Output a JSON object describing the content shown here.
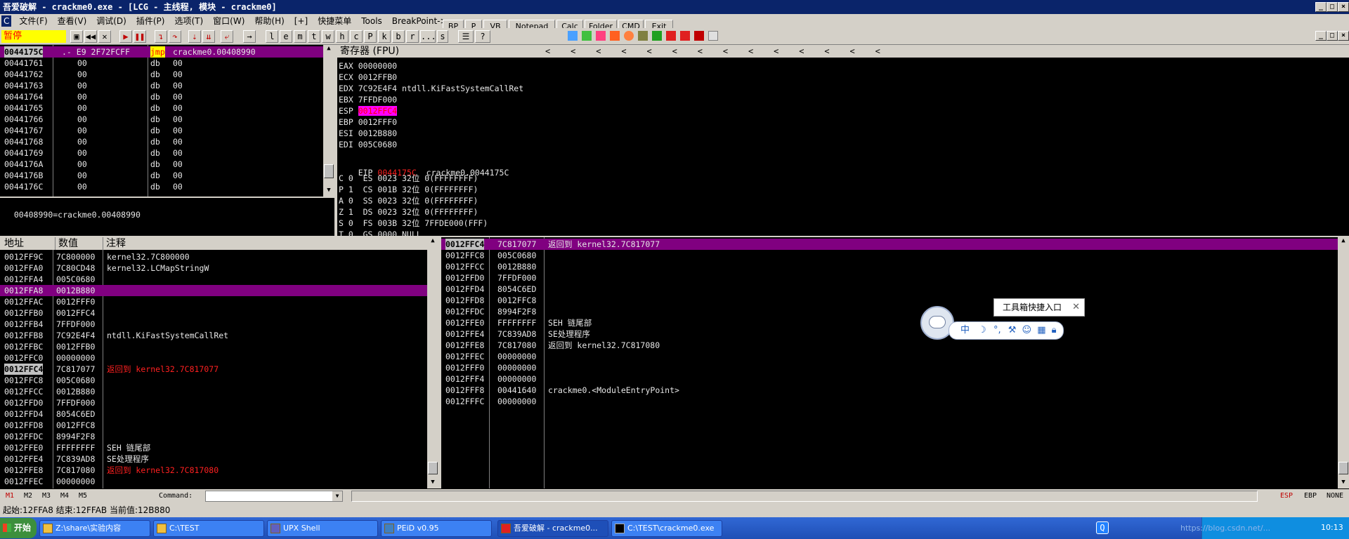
{
  "window": {
    "title": "吾爱破解 - crackme0.exe - [LCG - 主线程, 模块 - crackme0]"
  },
  "menu": [
    "C",
    "文件(F)",
    "查看(V)",
    "调试(D)",
    "插件(P)",
    "选项(T)",
    "窗口(W)",
    "帮助(H)",
    "[+]",
    "快捷菜单",
    "Tools",
    "BreakPoint->"
  ],
  "status_badge": "暂停",
  "toolbar_letters": [
    "l",
    "e",
    "m",
    "t",
    "w",
    "h",
    "c",
    "P",
    "k",
    "b",
    "r",
    "...",
    "s"
  ],
  "plugins": [
    "BP",
    "P",
    "VB",
    "Notepad",
    "Calc",
    "Folder",
    "CMD",
    "Exit"
  ],
  "disasm": {
    "rows": [
      {
        "addr": "0044175C",
        "hex": ".- E9 2F72FCFF",
        "cmd": "jmp",
        "arg": "crackme0.00408990"
      },
      {
        "addr": "00441761",
        "hex": "00",
        "cmd": "db",
        "arg": "00"
      },
      {
        "addr": "00441762",
        "hex": "00",
        "cmd": "db",
        "arg": "00"
      },
      {
        "addr": "00441763",
        "hex": "00",
        "cmd": "db",
        "arg": "00"
      },
      {
        "addr": "00441764",
        "hex": "00",
        "cmd": "db",
        "arg": "00"
      },
      {
        "addr": "00441765",
        "hex": "00",
        "cmd": "db",
        "arg": "00"
      },
      {
        "addr": "00441766",
        "hex": "00",
        "cmd": "db",
        "arg": "00"
      },
      {
        "addr": "00441767",
        "hex": "00",
        "cmd": "db",
        "arg": "00"
      },
      {
        "addr": "00441768",
        "hex": "00",
        "cmd": "db",
        "arg": "00"
      },
      {
        "addr": "00441769",
        "hex": "00",
        "cmd": "db",
        "arg": "00"
      },
      {
        "addr": "0044176A",
        "hex": "00",
        "cmd": "db",
        "arg": "00"
      },
      {
        "addr": "0044176B",
        "hex": "00",
        "cmd": "db",
        "arg": "00"
      },
      {
        "addr": "0044176C",
        "hex": "00",
        "cmd": "db",
        "arg": "00"
      }
    ],
    "info": "00408990=crackme0.00408990"
  },
  "registers": {
    "title": "寄存器 (FPU)",
    "arrows": "<    <    <    <    <    <    <    <    <    <    <    <    <    <",
    "gp": [
      {
        "name": "EAX",
        "value": "00000000",
        "note": ""
      },
      {
        "name": "ECX",
        "value": "0012FFB0",
        "note": ""
      },
      {
        "name": "EDX",
        "value": "7C92E4F4",
        "note": "ntdll.KiFastSystemCallRet"
      },
      {
        "name": "EBX",
        "value": "7FFDF000",
        "note": ""
      },
      {
        "name": "ESP",
        "value": "0012FFC4",
        "note": ""
      },
      {
        "name": "EBP",
        "value": "0012FFF0",
        "note": ""
      },
      {
        "name": "ESI",
        "value": "0012B880",
        "note": ""
      },
      {
        "name": "EDI",
        "value": "005C0680",
        "note": ""
      }
    ],
    "eip": {
      "name": "EIP",
      "value": "0044175C",
      "note": "crackme0.0044175C"
    },
    "flags": [
      "C 0  ES 0023 32位 0(FFFFFFFF)",
      "P 1  CS 001B 32位 0(FFFFFFFF)",
      "A 0  SS 0023 32位 0(FFFFFFFF)",
      "Z 1  DS 0023 32位 0(FFFFFFFF)",
      "S 0  FS 003B 32位 7FFDE000(FFF)",
      "T 0  GS 0000 NULL"
    ]
  },
  "dump": {
    "headers": [
      "地址",
      "数值",
      "注释"
    ],
    "rows": [
      {
        "addr": "0012FF9C",
        "val": "7C800000",
        "note": "kernel32.7C800000"
      },
      {
        "addr": "0012FFA0",
        "val": "7C80CD48",
        "note": "kernel32.LCMapStringW"
      },
      {
        "addr": "0012FFA4",
        "val": "005C0680",
        "note": ""
      },
      {
        "addr": "0012FFA8",
        "val": "0012B880",
        "note": ""
      },
      {
        "addr": "0012FFAC",
        "val": "0012FFF0",
        "note": ""
      },
      {
        "addr": "0012FFB0",
        "val": "0012FFC4",
        "note": ""
      },
      {
        "addr": "0012FFB4",
        "val": "7FFDF000",
        "note": ""
      },
      {
        "addr": "0012FFB8",
        "val": "7C92E4F4",
        "note": "ntdll.KiFastSystemCallRet"
      },
      {
        "addr": "0012FFBC",
        "val": "0012FFB0",
        "note": ""
      },
      {
        "addr": "0012FFC0",
        "val": "00000000",
        "note": ""
      },
      {
        "addr": "0012FFC4",
        "val": "7C817077",
        "note": "返回到 kernel32.7C817077"
      },
      {
        "addr": "0012FFC8",
        "val": "005C0680",
        "note": ""
      },
      {
        "addr": "0012FFCC",
        "val": "0012B880",
        "note": ""
      },
      {
        "addr": "0012FFD0",
        "val": "7FFDF000",
        "note": ""
      },
      {
        "addr": "0012FFD4",
        "val": "8054C6ED",
        "note": ""
      },
      {
        "addr": "0012FFD8",
        "val": "0012FFC8",
        "note": ""
      },
      {
        "addr": "0012FFDC",
        "val": "8994F2F8",
        "note": ""
      },
      {
        "addr": "0012FFE0",
        "val": "FFFFFFFF",
        "note": "SEH 链尾部"
      },
      {
        "addr": "0012FFE4",
        "val": "7C839AD8",
        "note": "SE处理程序"
      },
      {
        "addr": "0012FFE8",
        "val": "7C817080",
        "note": "返回到 kernel32.7C817080"
      },
      {
        "addr": "0012FFEC",
        "val": "00000000",
        "note": ""
      }
    ]
  },
  "stack": {
    "rows": [
      {
        "addr": "0012FFC4",
        "val": "7C817077",
        "note": "返回到 kernel32.7C817077"
      },
      {
        "addr": "0012FFC8",
        "val": "005C0680",
        "note": ""
      },
      {
        "addr": "0012FFCC",
        "val": "0012B880",
        "note": ""
      },
      {
        "addr": "0012FFD0",
        "val": "7FFDF000",
        "note": ""
      },
      {
        "addr": "0012FFD4",
        "val": "8054C6ED",
        "note": ""
      },
      {
        "addr": "0012FFD8",
        "val": "0012FFC8",
        "note": ""
      },
      {
        "addr": "0012FFDC",
        "val": "8994F2F8",
        "note": ""
      },
      {
        "addr": "0012FFE0",
        "val": "FFFFFFFF",
        "note": "SEH 链尾部"
      },
      {
        "addr": "0012FFE4",
        "val": "7C839AD8",
        "note": "SE处理程序"
      },
      {
        "addr": "0012FFE8",
        "val": "7C817080",
        "note": "返回到 kernel32.7C817080"
      },
      {
        "addr": "0012FFEC",
        "val": "00000000",
        "note": ""
      },
      {
        "addr": "0012FFF0",
        "val": "00000000",
        "note": ""
      },
      {
        "addr": "0012FFF4",
        "val": "00000000",
        "note": ""
      },
      {
        "addr": "0012FFF8",
        "val": "00441640",
        "note": "crackme0.<ModuleEntryPoint>"
      },
      {
        "addr": "0012FFFC",
        "val": "00000000",
        "note": ""
      }
    ]
  },
  "tooltip": {
    "text": "工具箱快捷入口",
    "ime_char": "中"
  },
  "cmdbar": {
    "marks": [
      "M1",
      "M2",
      "M3",
      "M4",
      "M5"
    ],
    "command_label": "Command:",
    "right": [
      "ESP",
      "EBP",
      "NONE"
    ]
  },
  "status": "起始:12FFA8 结束:12FFAB 当前值:12B880",
  "taskbar": {
    "start": "开始",
    "tasks": [
      "Z:\\share\\实验内容",
      "C:\\TEST",
      "UPX Shell",
      "PEiD v0.95",
      "吾爱破解 - crackme0...",
      "C:\\TEST\\crackme0.exe"
    ],
    "clock": "10:13",
    "watermark": "https://blog.csdn.net/..."
  },
  "colors": {
    "selection": "#800080",
    "red": "#ff2020",
    "face": "#d4d0c8",
    "titlebar": "#0a246a"
  }
}
